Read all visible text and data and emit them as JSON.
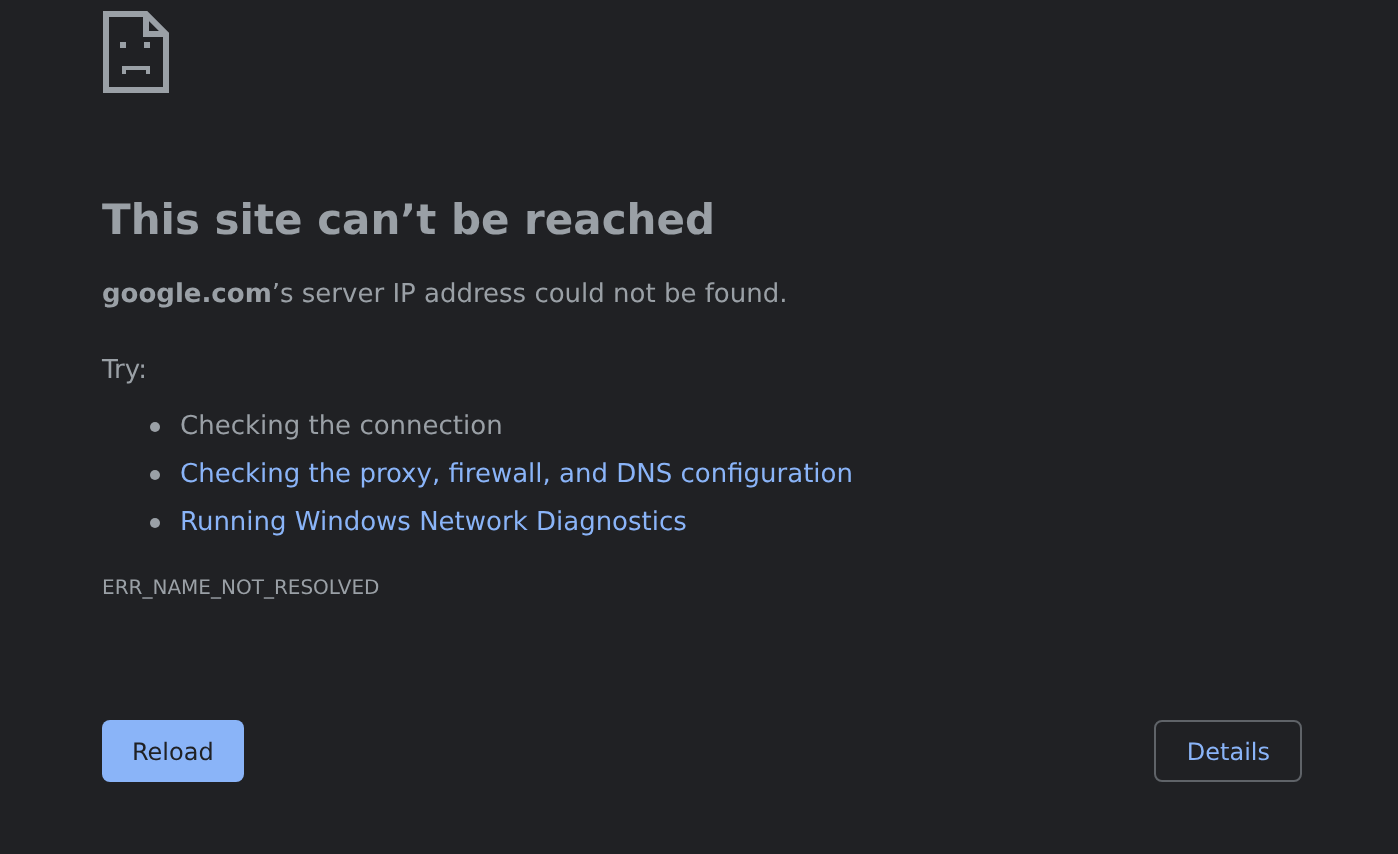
{
  "heading": "This site can’t be reached",
  "message": "**google.com**’s server IP address could not be found.",
  "try_label": "Try:",
  "suggestions": [
    {
      "kind": "text",
      "label": "Checking the connection"
    },
    {
      "kind": "link",
      "label": "Checking the proxy, firewall, and DNS configuration"
    },
    {
      "kind": "link",
      "label": "Running Windows Network Diagnostics"
    }
  ],
  "error_code": "ERR_NAME_NOT_RESOLVED",
  "buttons": {
    "reload": "Reload",
    "details": "Details"
  }
}
